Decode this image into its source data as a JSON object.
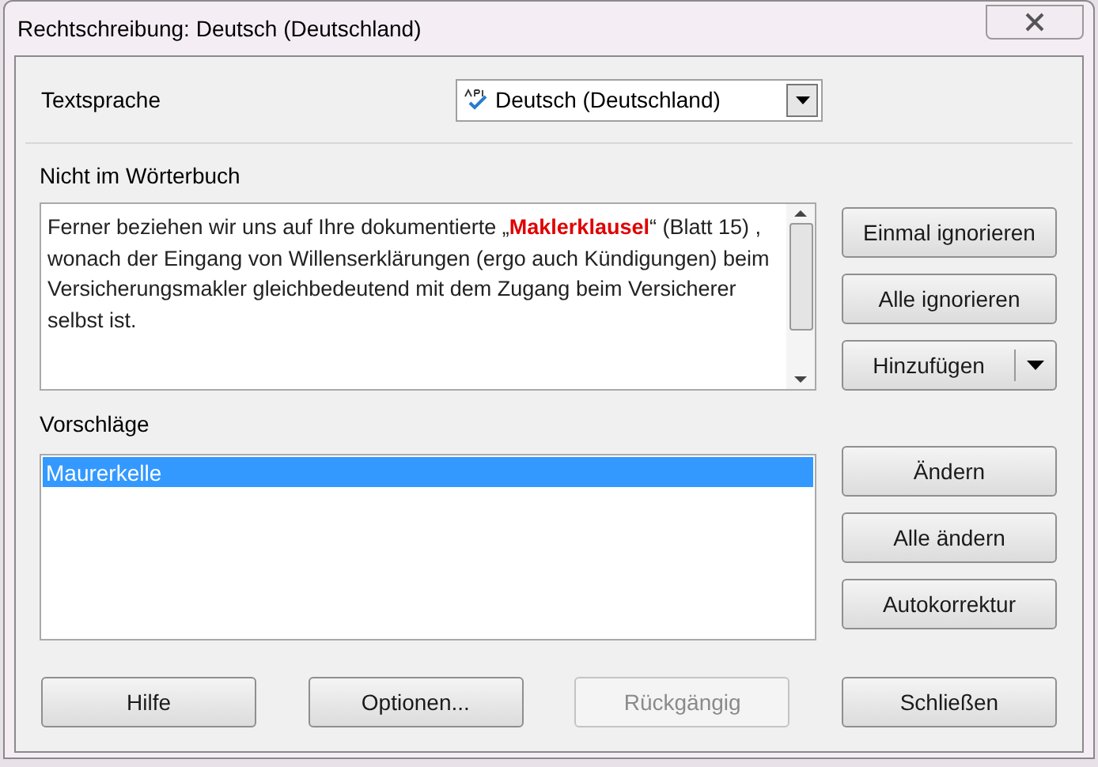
{
  "window": {
    "title": "Rechtschreibung: Deutsch (Deutschland)"
  },
  "language": {
    "label": "Textsprache",
    "value": "Deutsch (Deutschland)"
  },
  "not_in_dictionary": {
    "label": "Nicht im Wörterbuch",
    "text": "Ferner beziehen wir uns auf Ihre dokumentierte „**Maklerklausel**“ (Blatt 15) , wonach der Eingang von Willenserklärungen (ergo auch Kündigungen) beim Versicherungsmakler gleichbedeutend mit dem Zugang beim Versicherer selbst ist."
  },
  "ignore_buttons": [
    {
      "label": "Einmal ignorieren",
      "kind": "plain"
    },
    {
      "label": "Alle ignorieren",
      "kind": "plain"
    },
    {
      "label": "Hinzufügen",
      "kind": "split"
    }
  ],
  "suggestions": {
    "label": "Vorschläge",
    "items": [
      {
        "text": "Maurerkelle",
        "selected": true
      }
    ]
  },
  "change_buttons": [
    {
      "label": "Ändern"
    },
    {
      "label": "Alle ändern"
    },
    {
      "label": "Autokorrektur"
    }
  ],
  "footer_buttons": [
    {
      "label": "Hilfe",
      "disabled": false
    },
    {
      "label": "Optionen...",
      "disabled": false
    },
    {
      "label": "Rückgängig",
      "disabled": true
    },
    {
      "label": "Schließen",
      "disabled": false
    }
  ]
}
